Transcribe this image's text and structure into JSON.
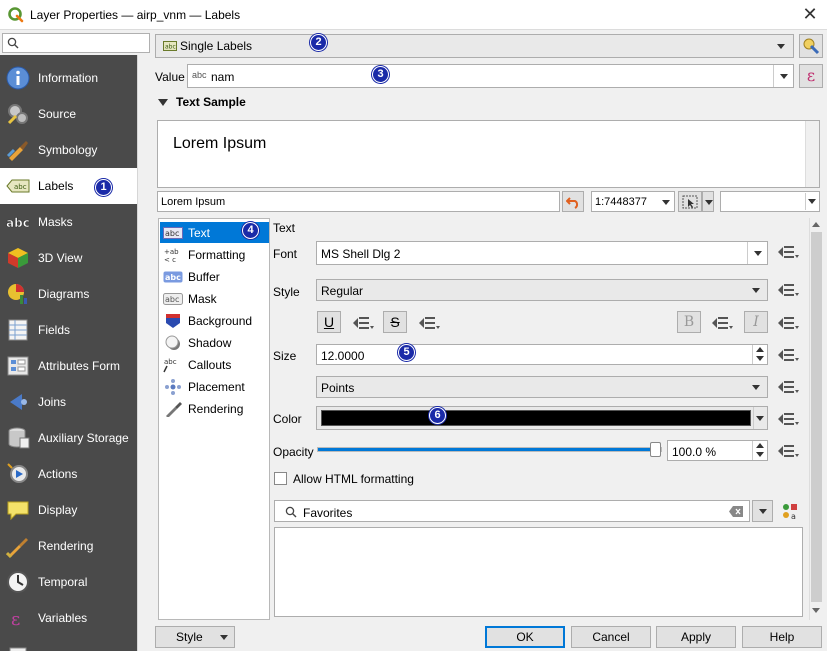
{
  "window": {
    "title": "Layer Properties — airp_vnm — Labels",
    "close_glyph": "✕"
  },
  "sidebar": {
    "items": [
      {
        "label": "Information",
        "icon": "info-icon"
      },
      {
        "label": "Source",
        "icon": "source-icon"
      },
      {
        "label": "Symbology",
        "icon": "symbology-icon"
      },
      {
        "label": "Labels",
        "icon": "labels-icon"
      },
      {
        "label": "Masks",
        "icon": "masks-icon"
      },
      {
        "label": "3D View",
        "icon": "3d-view-icon"
      },
      {
        "label": "Diagrams",
        "icon": "diagrams-icon"
      },
      {
        "label": "Fields",
        "icon": "fields-icon"
      },
      {
        "label": "Attributes Form",
        "icon": "attributes-form-icon"
      },
      {
        "label": "Joins",
        "icon": "joins-icon"
      },
      {
        "label": "Auxiliary Storage",
        "icon": "auxiliary-storage-icon"
      },
      {
        "label": "Actions",
        "icon": "actions-icon"
      },
      {
        "label": "Display",
        "icon": "display-icon"
      },
      {
        "label": "Rendering",
        "icon": "rendering-icon"
      },
      {
        "label": "Temporal",
        "icon": "temporal-icon"
      },
      {
        "label": "Variables",
        "icon": "variables-icon"
      }
    ],
    "selected": "Labels"
  },
  "labeling": {
    "mode": "Single Labels",
    "value_label": "Value",
    "value_field": "nam",
    "value_field_prefix": "abc",
    "mode_prefix": "abc"
  },
  "text_sample": {
    "heading": "Text Sample",
    "preview_text": "Lorem Ipsum",
    "sample_input": "Lorem Ipsum",
    "scale": "1:7448377"
  },
  "categories": [
    {
      "label": "Text",
      "icon": "text-abc-icon"
    },
    {
      "label": "Formatting",
      "icon": "formatting-icon"
    },
    {
      "label": "Buffer",
      "icon": "buffer-icon"
    },
    {
      "label": "Mask",
      "icon": "mask-icon"
    },
    {
      "label": "Background",
      "icon": "background-icon"
    },
    {
      "label": "Shadow",
      "icon": "shadow-icon"
    },
    {
      "label": "Callouts",
      "icon": "callouts-icon"
    },
    {
      "label": "Placement",
      "icon": "placement-icon"
    },
    {
      "label": "Rendering",
      "icon": "rendering-icon"
    }
  ],
  "text_panel": {
    "section": "Text",
    "font_label": "Font",
    "font_value": "MS Shell Dlg 2",
    "style_label": "Style",
    "style_value": "Regular",
    "underline": "U",
    "strike": "S",
    "bold": "B",
    "italic": "I",
    "size_label": "Size",
    "size_value": "12.0000",
    "unit_value": "Points",
    "color_label": "Color",
    "color_value": "#000000",
    "opacity_label": "Opacity",
    "opacity_value": "100.0 %",
    "opacity_fraction": 1.0,
    "html_label": "Allow HTML formatting",
    "favorites_placeholder": "Favorites"
  },
  "badges": [
    "1",
    "2",
    "3",
    "4",
    "5",
    "6"
  ],
  "buttons": {
    "style": "Style",
    "ok": "OK",
    "cancel": "Cancel",
    "apply": "Apply",
    "help": "Help"
  },
  "colors": {
    "sidebar_bg": "#4a4a4a",
    "selection": "#0078d7",
    "badge": "#1a2aa8",
    "slider": "#0078d7"
  }
}
